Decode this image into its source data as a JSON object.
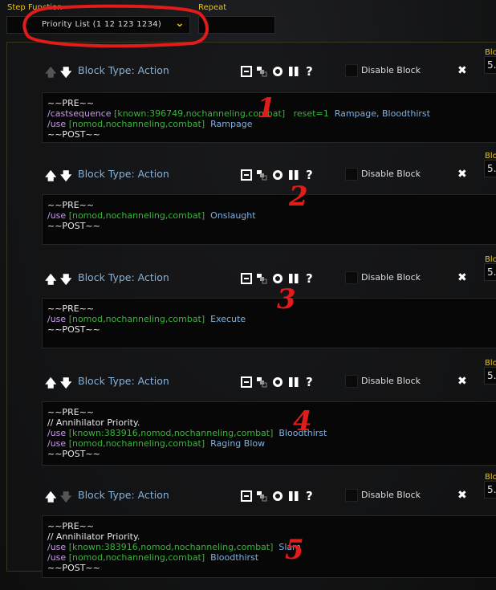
{
  "top": {
    "step_function_label": "Step Function",
    "step_function_value": "Priority List (1 12 123 1234)",
    "repeat_label": "Repeat"
  },
  "colors": {
    "label": "#e8c21c",
    "block_type": "#86b2d9",
    "macro_cmd": "#c99be6",
    "conditions": "#3bb33b",
    "spell": "#7fb0e0",
    "annotation": "#e21b1b"
  },
  "blocks": [
    {
      "type_label": "Block Type: Action",
      "disable_label": "Disable Block",
      "block_label": "Blo",
      "block_value": "5.",
      "up_enabled": false,
      "down_enabled": true,
      "annotation": "1",
      "lines": [
        [
          [
            "w",
            "~~PRE~~"
          ]
        ],
        [
          [
            "p",
            "/castsequence "
          ],
          [
            "g",
            "[known:396749,nochanneling,combat]   reset=1  "
          ],
          [
            "b",
            "Rampage, Bloodthirst"
          ]
        ],
        [
          [
            "p",
            "/use "
          ],
          [
            "g",
            "[nomod,nochanneling,combat]  "
          ],
          [
            "b",
            "Rampage"
          ]
        ],
        [
          [
            "w",
            "~~POST~~"
          ]
        ]
      ]
    },
    {
      "type_label": "Block Type: Action",
      "disable_label": "Disable Block",
      "block_label": "Blo",
      "block_value": "5.",
      "up_enabled": true,
      "down_enabled": true,
      "annotation": "2",
      "lines": [
        [
          [
            "w",
            "~~PRE~~"
          ]
        ],
        [
          [
            "p",
            "/use "
          ],
          [
            "g",
            "[nomod,nochanneling,combat]  "
          ],
          [
            "b",
            "Onslaught"
          ]
        ],
        [
          [
            "w",
            "~~POST~~"
          ]
        ]
      ]
    },
    {
      "type_label": "Block Type: Action",
      "disable_label": "Disable Block",
      "block_label": "Blo",
      "block_value": "5.",
      "up_enabled": true,
      "down_enabled": true,
      "annotation": "3",
      "lines": [
        [
          [
            "w",
            "~~PRE~~"
          ]
        ],
        [
          [
            "p",
            "/use "
          ],
          [
            "g",
            "[nomod,nochanneling,combat]  "
          ],
          [
            "b",
            "Execute"
          ]
        ],
        [
          [
            "w",
            "~~POST~~"
          ]
        ]
      ]
    },
    {
      "type_label": "Block Type: Action",
      "disable_label": "Disable Block",
      "block_label": "Blo",
      "block_value": "5.",
      "up_enabled": true,
      "down_enabled": true,
      "annotation": "4",
      "lines": [
        [
          [
            "w",
            "~~PRE~~"
          ]
        ],
        [
          [
            "w",
            "// Annihilator Priority."
          ]
        ],
        [
          [
            "p",
            "/use "
          ],
          [
            "g",
            "[known:383916,nomod,nochanneling,combat]  "
          ],
          [
            "b",
            "Bloodthirst"
          ]
        ],
        [
          [
            "p",
            "/use "
          ],
          [
            "g",
            "[nomod,nochanneling,combat]  "
          ],
          [
            "b",
            "Raging Blow"
          ]
        ],
        [
          [
            "w",
            "~~POST~~"
          ]
        ]
      ]
    },
    {
      "type_label": "Block Type: Action",
      "disable_label": "Disable Block",
      "block_label": "Blo",
      "block_value": "5.",
      "up_enabled": true,
      "down_enabled": false,
      "annotation": "5",
      "lines": [
        [
          [
            "w",
            "~~PRE~~"
          ]
        ],
        [
          [
            "w",
            "// Annihilator Priority."
          ]
        ],
        [
          [
            "p",
            "/use "
          ],
          [
            "g",
            "[known:383916,nomod,nochanneling,combat]  "
          ],
          [
            "b",
            "Slam"
          ]
        ],
        [
          [
            "p",
            "/use "
          ],
          [
            "g",
            "[nomod,nochanneling,combat]  "
          ],
          [
            "b",
            "Bloodthirst"
          ]
        ],
        [
          [
            "w",
            "~~POST~~"
          ]
        ]
      ]
    }
  ]
}
